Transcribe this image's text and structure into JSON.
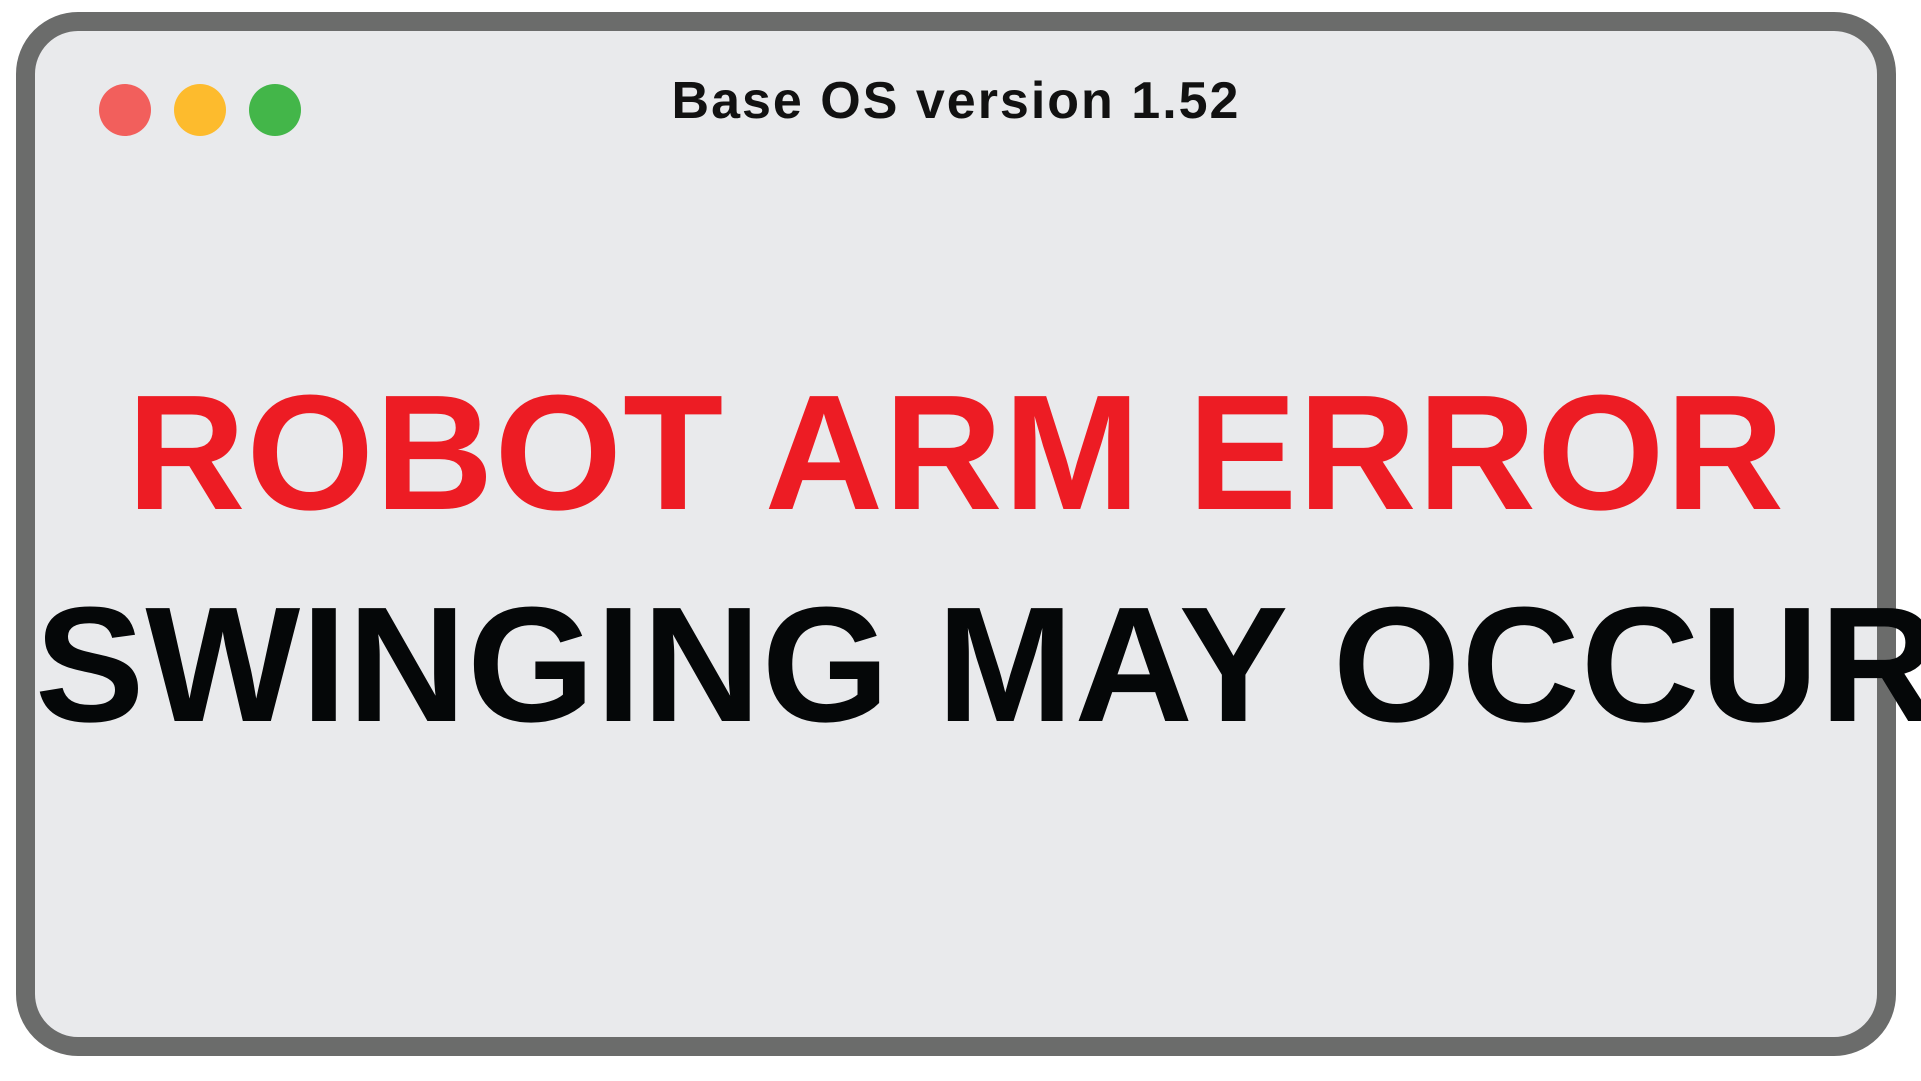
{
  "window": {
    "title": "Base OS version 1.52",
    "controls": [
      {
        "name": "close-button",
        "color": "#f25f5c"
      },
      {
        "name": "minimize-button",
        "color": "#fdbb2d"
      },
      {
        "name": "zoom-button",
        "color": "#43b649"
      }
    ]
  },
  "alert": {
    "error_text": "ROBOT ARM ERROR",
    "warning_text": "SWINGING MAY OCCUR"
  },
  "colors": {
    "error": "#ed1c24",
    "warning": "#050708",
    "window_bg": "#e9eaec",
    "window_border": "#6b6c6b"
  }
}
